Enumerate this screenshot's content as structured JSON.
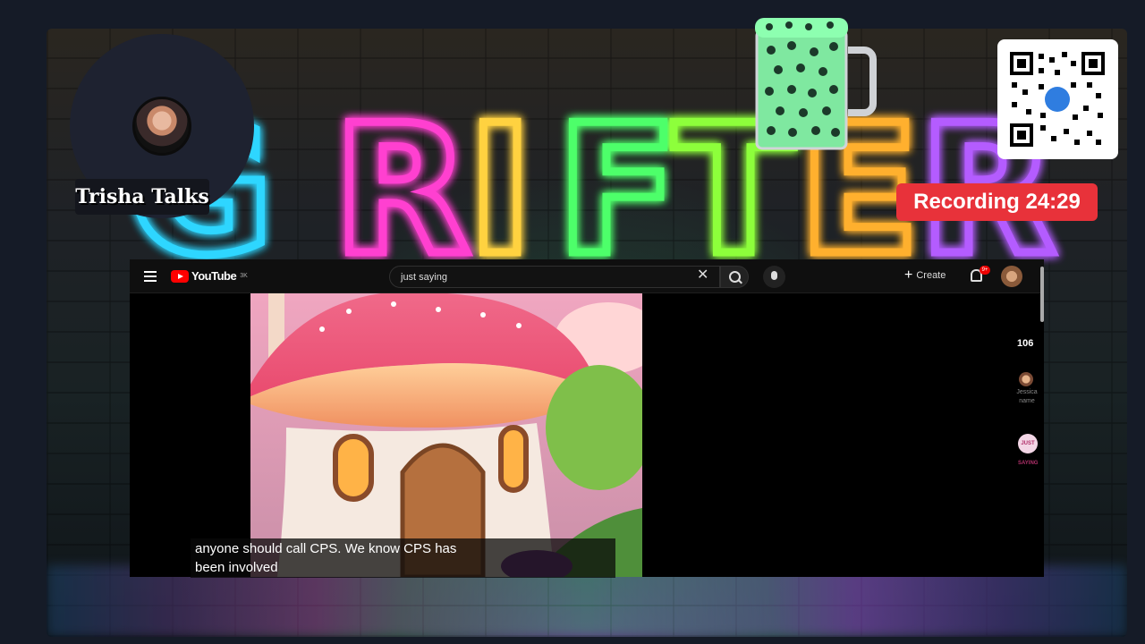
{
  "overlay": {
    "streamer_name": "Trisha Talks",
    "recording_label": "Recording 24:29",
    "neon_sign": "GRIFTER"
  },
  "youtube": {
    "logo_text": "YouTube",
    "logo_badge": "3K",
    "search_value": "just saying",
    "create_label": "Create",
    "notification_badge": "9+",
    "like_count": "106",
    "side_user_text": "Jessica\nname",
    "side_channel_badge": "JUST SAYING"
  },
  "video": {
    "caption_line1": "anyone should call CPS. We know CPS has",
    "caption_line2": "been involved"
  },
  "colors": {
    "record_red": "#e8323a",
    "youtube_red": "#ff0000",
    "neon_cyan": "#2fd6ff",
    "neon_pink": "#ff3fd0",
    "neon_yellow": "#ffd23f",
    "neon_green": "#4dff6a",
    "neon_purple": "#b45cff"
  }
}
